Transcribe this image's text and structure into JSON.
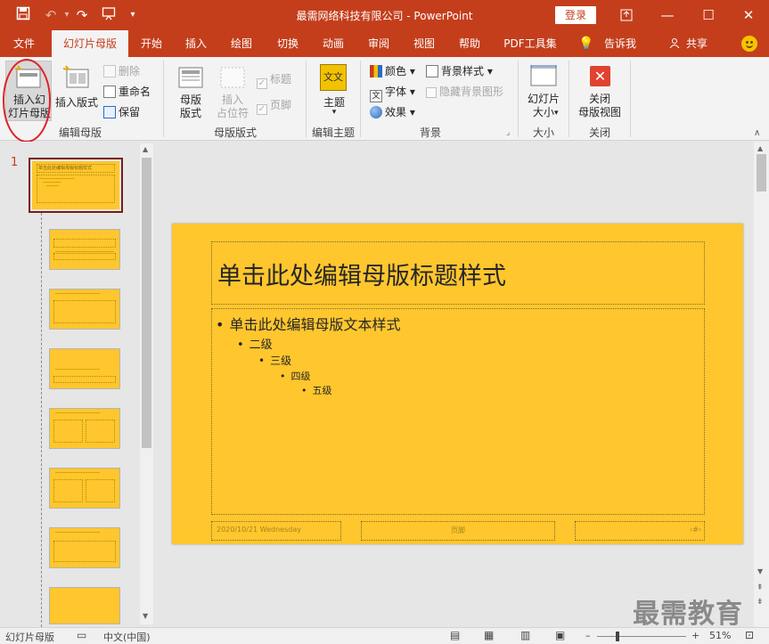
{
  "title_bar": {
    "doc_title": "最需网络科技有限公司  -  PowerPoint",
    "login_label": "登录"
  },
  "tabs": [
    {
      "label": "文件"
    },
    {
      "label": "幻灯片母版",
      "active": true
    },
    {
      "label": "开始"
    },
    {
      "label": "插入"
    },
    {
      "label": "绘图"
    },
    {
      "label": "切换"
    },
    {
      "label": "动画"
    },
    {
      "label": "审阅"
    },
    {
      "label": "视图"
    },
    {
      "label": "帮助"
    },
    {
      "label": "PDF工具集"
    },
    {
      "label": "告诉我"
    },
    {
      "label": "共享"
    }
  ],
  "ribbon": {
    "edit_master": {
      "label": "编辑母版",
      "insert_slide_master": "插入幻\n灯片母版",
      "insert_layout": "插入版式",
      "delete": "删除",
      "rename": "重命名",
      "preserve": "保留"
    },
    "master_layout": {
      "label": "母版版式",
      "master_layout_btn": "母版\n版式",
      "insert_placeholder": "插入\n占位符",
      "title_check": "标题",
      "footer_check": "页脚"
    },
    "edit_theme": {
      "label": "编辑主题",
      "theme": "主题",
      "theme_icon_text": "文文"
    },
    "background": {
      "label": "背景",
      "colors": "颜色",
      "fonts": "字体",
      "effects": "效果",
      "bg_styles": "背景样式",
      "hide_bg": "隐藏背景图形"
    },
    "size": {
      "label": "大小",
      "slide_size": "幻灯片\n大小"
    },
    "close": {
      "label": "关闭",
      "close_master_view": "关闭\n母版视图"
    }
  },
  "thumbnails": {
    "selected_number": "1",
    "first_title": "单击此处编辑母版标题样式"
  },
  "slide": {
    "title": "单击此处编辑母版标题样式",
    "body": [
      {
        "text": "单击此处编辑母版文本样式"
      },
      {
        "text": "二级"
      },
      {
        "text": "三级"
      },
      {
        "text": "四级"
      },
      {
        "text": "五级"
      }
    ],
    "footer_date": "2020/10/21 Wednesday",
    "footer_center": "页脚",
    "footer_number": "‹#›"
  },
  "status_bar": {
    "view": "幻灯片母版",
    "language": "中文(中国)",
    "zoom": "51%",
    "zoom_level": 0.51
  },
  "watermark": "最需教育",
  "colors": {
    "accent": "#c43e1c",
    "slide_bg": "#ffc62e",
    "ribbon_bg": "#f3f3f3"
  }
}
